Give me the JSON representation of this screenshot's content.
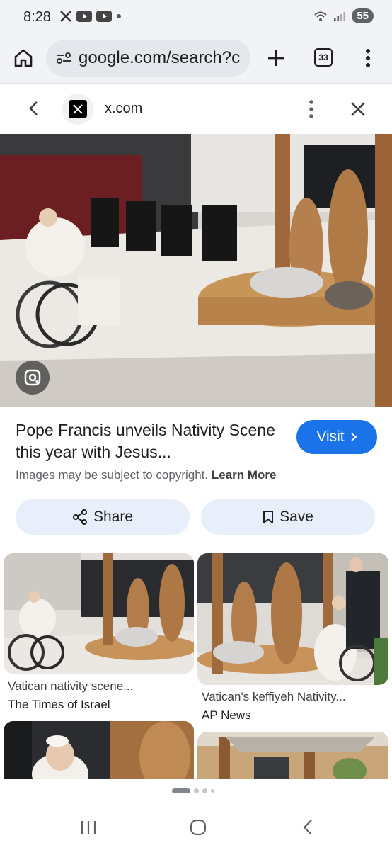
{
  "status_bar": {
    "time": "8:28",
    "battery": "55",
    "left_icons": [
      "x-app-icon",
      "youtube-icon",
      "youtube-icon",
      "dot-icon"
    ],
    "right_icons": [
      "wifi-icon",
      "signal-icon",
      "battery-icon"
    ]
  },
  "browser": {
    "url": "google.com/search?c",
    "tab_count": "33"
  },
  "sheet": {
    "site_name": "x.com",
    "title": "Pope Francis unveils Nativity Scene this year with Jesus...",
    "visit_label": "Visit",
    "copyright_text": "Images may be subject to copyright.",
    "learn_more_label": "Learn More",
    "share_label": "Share",
    "save_label": "Save"
  },
  "related": [
    {
      "title": "Vatican nativity scene...",
      "source": "The Times of Israel"
    },
    {
      "title": "Vatican's keffiyeh Nativity...",
      "source": "AP News"
    },
    {
      "title": "",
      "source": ""
    },
    {
      "title": "",
      "source": ""
    }
  ],
  "pager": {
    "count": 4,
    "active_index": 0
  },
  "colors": {
    "accent": "#1a73e8",
    "pill_bg": "#e8effa",
    "toolbar_bg": "#f1f3f6"
  }
}
